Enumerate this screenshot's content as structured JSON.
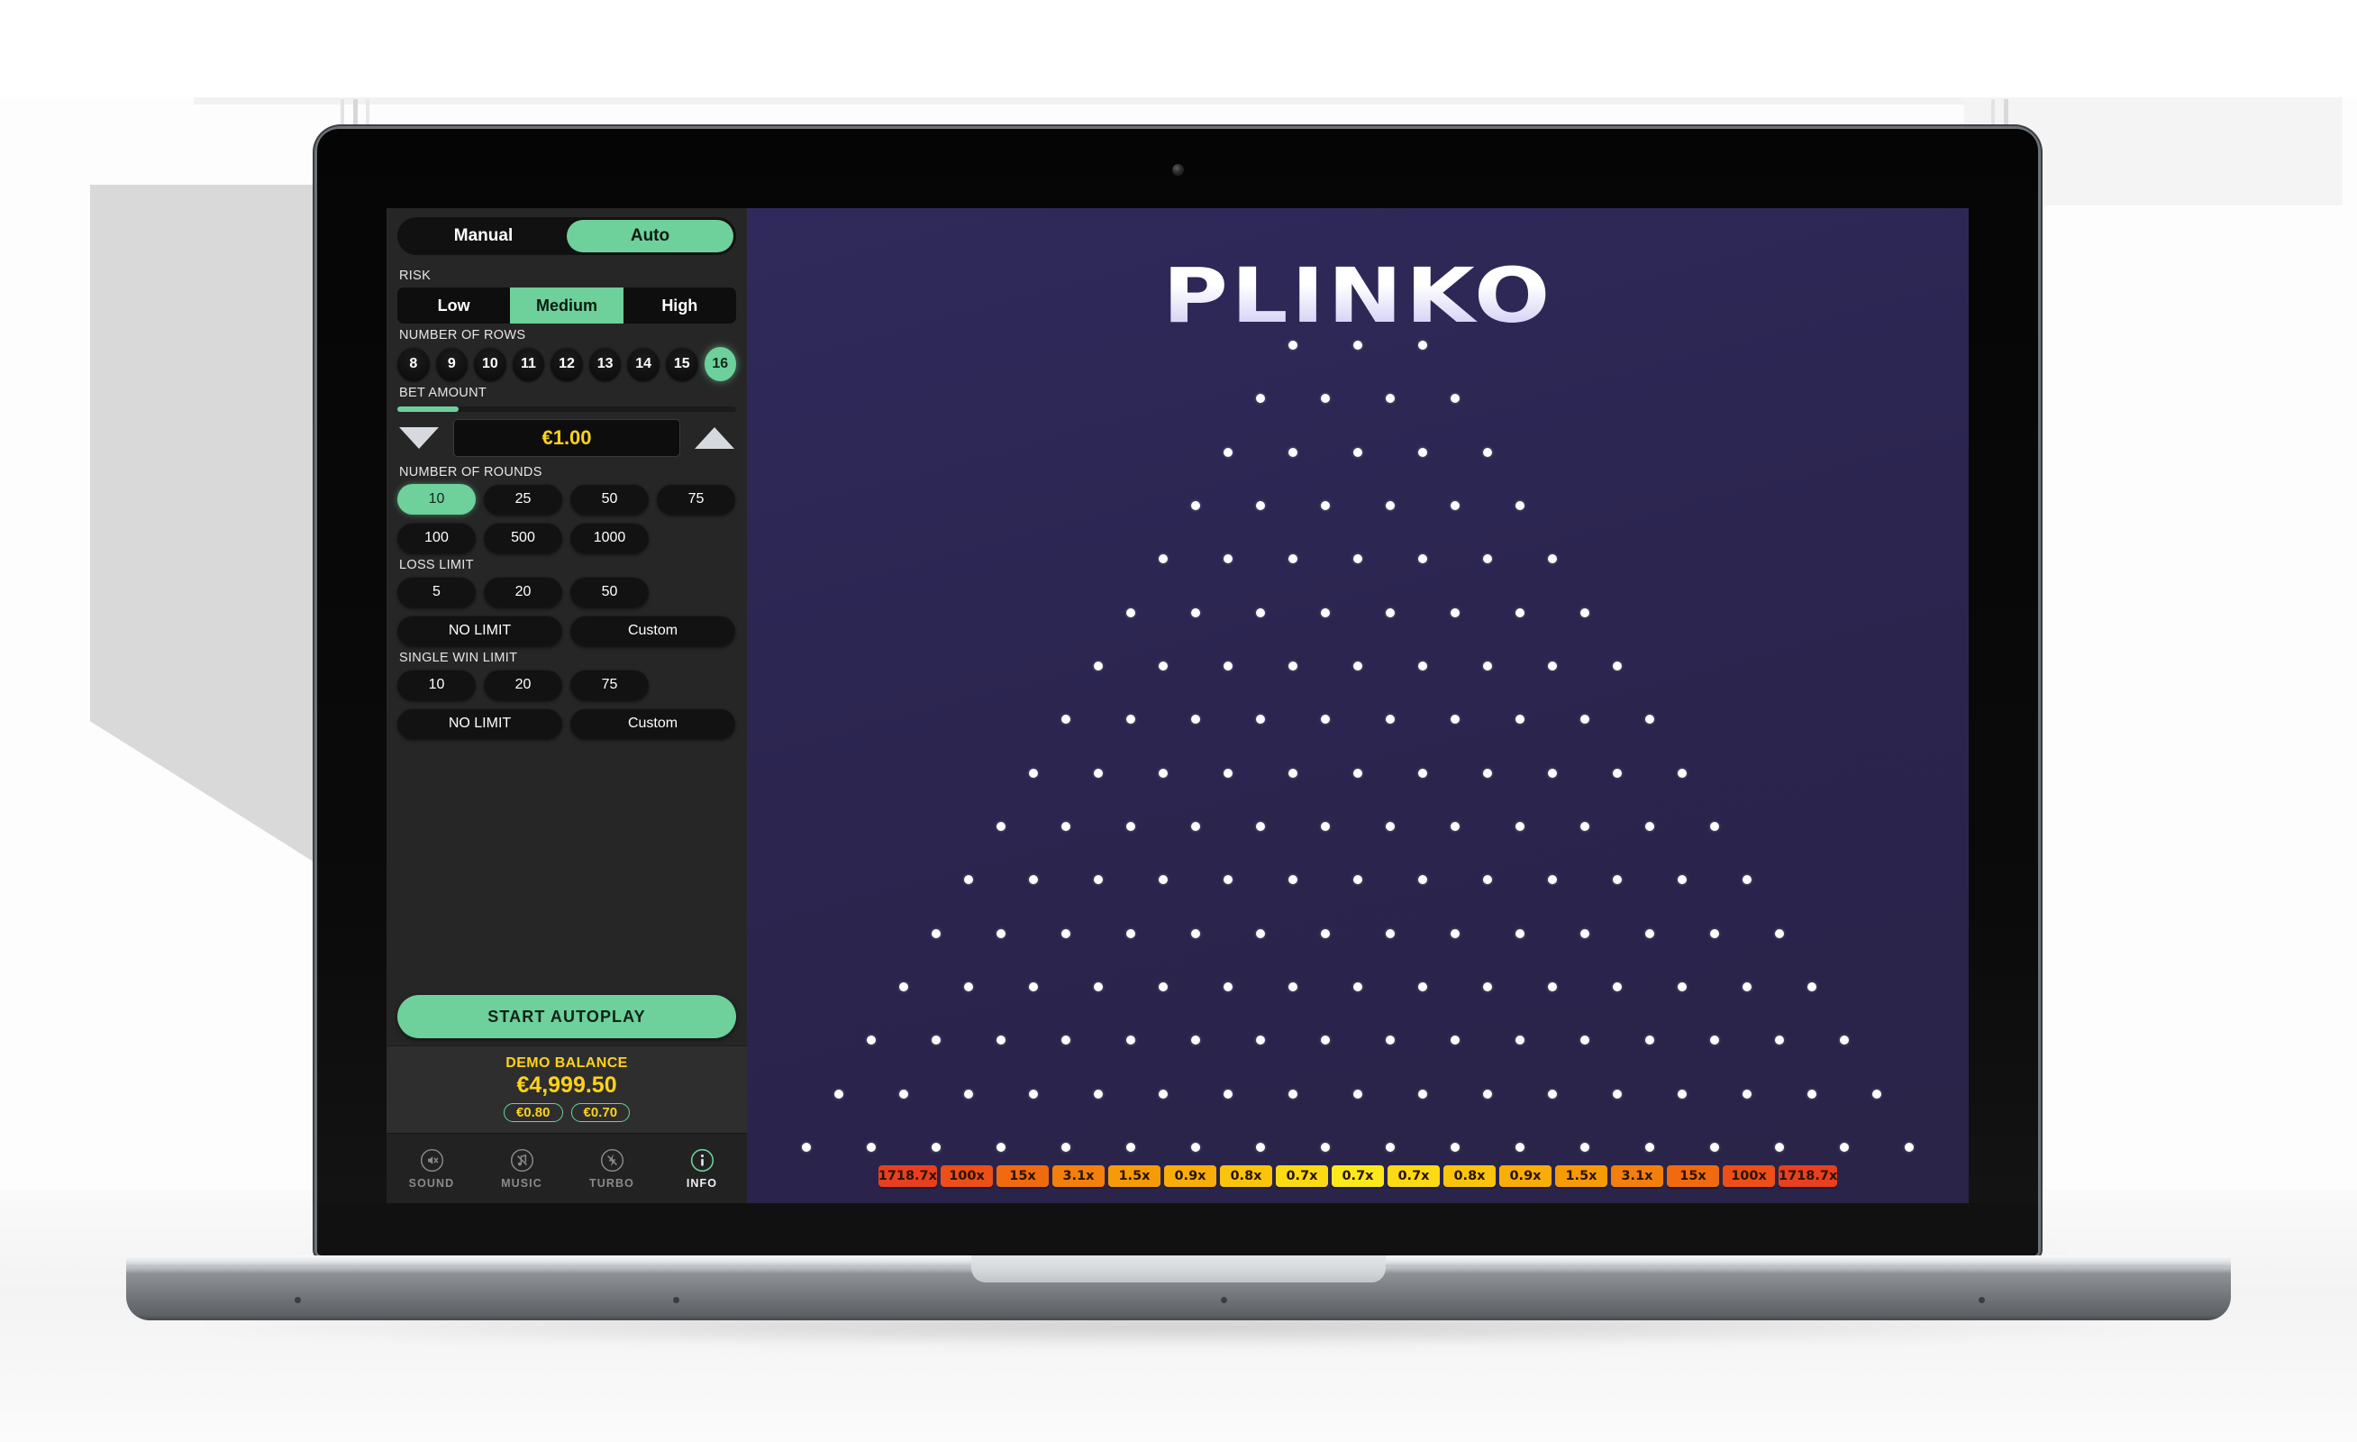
{
  "mode_tabs": [
    {
      "label": "Manual",
      "active": false
    },
    {
      "label": "Auto",
      "active": true
    }
  ],
  "risk": {
    "label": "RISK",
    "options": [
      {
        "label": "Low",
        "active": false
      },
      {
        "label": "Medium",
        "active": true
      },
      {
        "label": "High",
        "active": false
      }
    ]
  },
  "rows": {
    "label": "NUMBER OF ROWS",
    "options": [
      {
        "label": "8",
        "active": false
      },
      {
        "label": "9",
        "active": false
      },
      {
        "label": "10",
        "active": false
      },
      {
        "label": "11",
        "active": false
      },
      {
        "label": "12",
        "active": false
      },
      {
        "label": "13",
        "active": false
      },
      {
        "label": "14",
        "active": false
      },
      {
        "label": "15",
        "active": false
      },
      {
        "label": "16",
        "active": true
      }
    ],
    "selected": 16
  },
  "bet": {
    "label": "BET AMOUNT",
    "value": "€1.00",
    "slider_percent": 18,
    "decrease_icon": "triangle-down-icon",
    "increase_icon": "triangle-up-icon"
  },
  "rounds": {
    "label": "NUMBER OF ROUNDS",
    "options": [
      {
        "label": "10",
        "active": true
      },
      {
        "label": "25",
        "active": false
      },
      {
        "label": "50",
        "active": false
      },
      {
        "label": "75",
        "active": false
      },
      {
        "label": "100",
        "active": false
      },
      {
        "label": "500",
        "active": false
      },
      {
        "label": "1000",
        "active": false
      }
    ]
  },
  "loss_limit": {
    "label": "LOSS LIMIT",
    "options": [
      {
        "label": "5",
        "active": false
      },
      {
        "label": "20",
        "active": false
      },
      {
        "label": "50",
        "active": false
      }
    ],
    "wide_options": [
      {
        "label": "NO LIMIT",
        "active": false
      },
      {
        "label": "Custom",
        "active": false
      }
    ]
  },
  "single_win_limit": {
    "label": "SINGLE WIN LIMIT",
    "options": [
      {
        "label": "10",
        "active": false
      },
      {
        "label": "20",
        "active": false
      },
      {
        "label": "75",
        "active": false
      }
    ],
    "wide_options": [
      {
        "label": "NO LIMIT",
        "active": false
      },
      {
        "label": "Custom",
        "active": false
      }
    ]
  },
  "start_button": {
    "label": "START AUTOPLAY"
  },
  "balance": {
    "title": "DEMO BALANCE",
    "amount": "€4,999.50",
    "chips": [
      "€0.80",
      "€0.70"
    ]
  },
  "toolbar": [
    {
      "label": "SOUND",
      "icon": "sound-muted-icon",
      "active": false
    },
    {
      "label": "MUSIC",
      "icon": "music-off-icon",
      "active": false
    },
    {
      "label": "TURBO",
      "icon": "turbo-off-icon",
      "active": false
    },
    {
      "label": "INFO",
      "icon": "info-icon",
      "active": true
    }
  ],
  "game": {
    "logo": "PLINKO",
    "background_color": "#2b2550",
    "peg_color": "#fdfdfd",
    "peg_rows": 16,
    "peg_first_row_count": 3,
    "multipliers": [
      {
        "label": "1718.7x",
        "color": "#e8401f"
      },
      {
        "label": "100x",
        "color": "#ec4f18"
      },
      {
        "label": "15x",
        "color": "#f06a10"
      },
      {
        "label": "3.1x",
        "color": "#f3800c"
      },
      {
        "label": "1.5x",
        "color": "#f79a08"
      },
      {
        "label": "0.9x",
        "color": "#f9ad09"
      },
      {
        "label": "0.8x",
        "color": "#fbc40c"
      },
      {
        "label": "0.7x",
        "color": "#fcd915"
      },
      {
        "label": "0.7x",
        "color": "#fce91c"
      },
      {
        "label": "0.7x",
        "color": "#fcd915"
      },
      {
        "label": "0.8x",
        "color": "#fbc40c"
      },
      {
        "label": "0.9x",
        "color": "#f9ad09"
      },
      {
        "label": "1.5x",
        "color": "#f79a08"
      },
      {
        "label": "3.1x",
        "color": "#f3800c"
      },
      {
        "label": "15x",
        "color": "#f06a10"
      },
      {
        "label": "100x",
        "color": "#ec4f18"
      },
      {
        "label": "1718.7x",
        "color": "#e8401f"
      }
    ]
  },
  "colors": {
    "accent_green": "#6ed09a",
    "gold": "#ffd21a",
    "panel_bg": "#262626",
    "game_bg": "#2b2550"
  }
}
